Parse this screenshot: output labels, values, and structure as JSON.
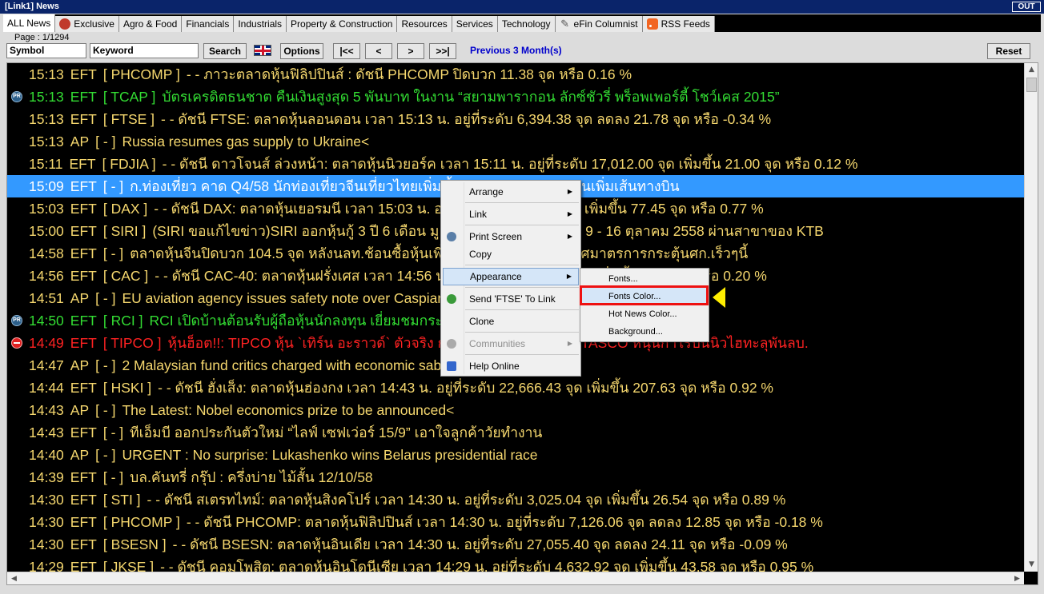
{
  "window": {
    "title": "[Link1] News",
    "out_label": "OUT"
  },
  "tabs": [
    {
      "label": "ALL News",
      "icon": ""
    },
    {
      "label": "Exclusive",
      "icon": "exclusive-icon"
    },
    {
      "label": "Agro & Food",
      "icon": ""
    },
    {
      "label": "Financials",
      "icon": ""
    },
    {
      "label": "Industrials",
      "icon": ""
    },
    {
      "label": "Property & Construction",
      "icon": ""
    },
    {
      "label": "Resources",
      "icon": ""
    },
    {
      "label": "Services",
      "icon": ""
    },
    {
      "label": "Technology",
      "icon": ""
    },
    {
      "label": "eFin Columnist",
      "icon": "pen-icon"
    },
    {
      "label": "RSS Feeds",
      "icon": "rss-icon"
    }
  ],
  "page_info": "Page : 1/1294",
  "controls": {
    "symbol_value": "Symbol",
    "keyword_value": "Keyword",
    "search_label": "Search",
    "options_label": "Options",
    "first_label": "|<<",
    "prev_label": "<",
    "next_label": ">",
    "last_label": ">>|",
    "previous_months_label": "Previous 3 Month(s)",
    "reset_label": "Reset"
  },
  "colors": {
    "normal": "#f5d76e",
    "pr": "#33dd33",
    "hot": "#ff2222",
    "selected_text": "#ffffff",
    "selected_bg": "#3399ff"
  },
  "news": [
    {
      "time": "15:13",
      "source": "EFT",
      "symbol": "[ PHCOMP ]",
      "text": "- - ภาวะตลาดหุ้นฟิลิปปินส์ :  ดัชนี PHCOMP  ปิดบวก   11.38 จุด หรือ 0.16 %",
      "type": "normal"
    },
    {
      "time": "15:13",
      "source": "EFT",
      "symbol": "[ TCAP ]",
      "text": "บัตรเครดิตธนชาต คืนเงินสูงสุด 5 พันบาท ในงาน “สยามพารากอน ลักซ์ชัวรี่ พร็อพเพอร์ตี้ โชว์เคส 2015”",
      "type": "pr"
    },
    {
      "time": "15:13",
      "source": "EFT",
      "symbol": "[ FTSE ]",
      "text": "- - ดัชนี FTSE: ตลาดหุ้นลอนดอน  เวลา 15:13 น.  อยู่ที่ระดับ 6,394.38 จุด ลดลง 21.78 จุด หรือ -0.34 %",
      "type": "normal"
    },
    {
      "time": "15:13",
      "source": "AP",
      "symbol": "[ - ]",
      "text": "Russia resumes gas supply to Ukraine<",
      "type": "normal"
    },
    {
      "time": "15:11",
      "source": "EFT",
      "symbol": "[ FDJIA ]",
      "text": "- - ดัชนี ดาวโจนส์ ล่วงหน้า: ตลาดหุ้นนิวยอร์ค  เวลา 15:11 น.  อยู่ที่ระดับ 17,012.00 จุด เพิ่มขึ้น 21.00 จุด หรือ 0.12 %",
      "type": "normal"
    },
    {
      "time": "15:09",
      "source": "EFT",
      "symbol": "[ - ]",
      "text": "ก.ท่องเที่ยว คาด Q4/58 นักท่องเที่ยวจีนเที่ยวไทยเพิ่มขึ้น หลังบริษัทสายการบินเพิ่มเส้นทางบิน",
      "type": "selected"
    },
    {
      "time": "15:03",
      "source": "EFT",
      "symbol": "[ DAX ]",
      "text": "- - ดัชนี DAX: ตลาดหุ้นเยอรมนี  เวลา 15:03 น.  อยู่ที่ระดับ 10,197.20 จุด เพิ่มขึ้น 77.45 จุด หรือ 0.77 %",
      "type": "normal"
    },
    {
      "time": "15:00",
      "source": "EFT",
      "symbol": "[ SIRI ]",
      "text": "(SIRI ขอแก้ไขข่าว)SIRI ออกหุ้นกู้ 3 ปี 6 เดือน มูลค่า 3,000 ลบ. เปิดขาย 9 - 16 ตุลาคม 2558 ผ่านสาขาของ KTB",
      "type": "normal"
    },
    {
      "time": "14:58",
      "source": "EFT",
      "symbol": "[ - ]",
      "text": "ตลาดหุ้นจีนปิดบวก 104.5 จุด หลังนลท.ช้อนซื้อหุ้นเพิ่ม คาดรัฐบาลจีนประกาศมาตรการกระตุ้นศก.เร็วๆนี้",
      "type": "normal"
    },
    {
      "time": "14:56",
      "source": "EFT",
      "symbol": "[ CAC ]",
      "text": "- - ดัชนี CAC-40: ตลาดหุ้นฝรั่งเศส  เวลา 14:56 น.  อยู่ที่ระดับ 4,657.17 จุด เพิ่มขึ้น 9.31 จุด หรือ 0.20 %",
      "type": "normal"
    },
    {
      "time": "14:51",
      "source": "AP",
      "symbol": "[ - ]",
      "text": "EU aviation agency issues safety note over Caspian Sea<",
      "type": "normal"
    },
    {
      "time": "14:50",
      "source": "EFT",
      "symbol": "[ RCI ]",
      "text": "RCI เปิดบ้านต้อนรับผู้ถือหุ้นนักลงทุน เยี่ยมชมกระบวนการผลิต",
      "type": "pr"
    },
    {
      "time": "14:49",
      "source": "EFT",
      "symbol": "[ TIPCO ]",
      "text": "หุ้นฮ็อต!!: TIPCO หุ้น `เทิร์น อะราวด์` ตัวจริง กำไรปีนี้พุ่ง พร้อมถือหุ้น TASCO หนุนกำไรปีนี้นิวไฮทะลุพันลบ.",
      "type": "hot"
    },
    {
      "time": "14:47",
      "source": "AP",
      "symbol": "[ - ]",
      "text": "2 Malaysian fund critics charged with economic sabotage<",
      "type": "normal"
    },
    {
      "time": "14:44",
      "source": "EFT",
      "symbol": "[ HSKI ]",
      "text": "- - ดัชนี ฮั่งเส็ง: ตลาดหุ้นฮ่องกง  เวลา 14:43 น.  อยู่ที่ระดับ 22,666.43 จุด เพิ่มขึ้น 207.63 จุด หรือ 0.92 %",
      "type": "normal"
    },
    {
      "time": "14:43",
      "source": "AP",
      "symbol": "[ - ]",
      "text": "The Latest: Nobel economics prize to be announced<",
      "type": "normal"
    },
    {
      "time": "14:43",
      "source": "EFT",
      "symbol": "[ - ]",
      "text": "ทีเอ็มบี ออกประกันตัวใหม่ “ไลฟ์ เซฟเว่อร์ 15/9” เอาใจลูกค้าวัยทำงาน",
      "type": "normal"
    },
    {
      "time": "14:40",
      "source": "AP",
      "symbol": "[ - ]",
      "text": "URGENT : No surprise: Lukashenko wins Belarus presidential race",
      "type": "normal"
    },
    {
      "time": "14:39",
      "source": "EFT",
      "symbol": "[ - ]",
      "text": "บล.คันทรี่ กรุ๊ป : ครึ่งบ่าย ไม้สั้น 12/10/58",
      "type": "normal"
    },
    {
      "time": "14:30",
      "source": "EFT",
      "symbol": "[ STI ]",
      "text": "- - ดัชนี สเตรทไทม์: ตลาดหุ้นสิงคโปร์  เวลา 14:30 น.  อยู่ที่ระดับ 3,025.04 จุด เพิ่มขึ้น 26.54 จุด หรือ 0.89 %",
      "type": "normal"
    },
    {
      "time": "14:30",
      "source": "EFT",
      "symbol": "[ PHCOMP ]",
      "text": "- - ดัชนี PHCOMP: ตลาดหุ้นฟิลิปปินส์  เวลา 14:30 น.  อยู่ที่ระดับ 7,126.06 จุด ลดลง 12.85 จุด หรือ -0.18 %",
      "type": "normal"
    },
    {
      "time": "14:30",
      "source": "EFT",
      "symbol": "[ BSESN ]",
      "text": "- - ดัชนี BSESN: ตลาดหุ้นอินเดีย  เวลา 14:30 น.  อยู่ที่ระดับ 27,055.40 จุด ลดลง 24.11 จุด หรือ -0.09 %",
      "type": "normal"
    },
    {
      "time": "14:29",
      "source": "EFT",
      "symbol": "[ JKSE ]",
      "text": "- - ดัชนี คอมโพสิต: ตลาดหุ้นอินโดนีเซีย  เวลา 14:29 น.  อยู่ที่ระดับ 4,632.92 จุด เพิ่มขึ้น 43.58 จุด หรือ 0.95 %",
      "type": "normal"
    }
  ],
  "context_menu": {
    "items": [
      {
        "label": "Arrange",
        "submenu": true,
        "disabled": false,
        "icon": ""
      },
      {
        "label": "Link",
        "submenu": true,
        "disabled": false,
        "icon": ""
      },
      {
        "label": "Print Screen",
        "submenu": true,
        "disabled": false,
        "icon": "printer-icon"
      },
      {
        "label": "Copy",
        "submenu": false,
        "disabled": false,
        "icon": ""
      },
      {
        "label": "Appearance",
        "submenu": true,
        "disabled": false,
        "icon": ""
      },
      {
        "label": "Send 'FTSE' To Link",
        "submenu": false,
        "disabled": false,
        "icon": "send-icon"
      },
      {
        "label": "Clone",
        "submenu": false,
        "disabled": false,
        "icon": ""
      },
      {
        "label": "Communities",
        "submenu": true,
        "disabled": true,
        "icon": "communities-icon"
      },
      {
        "label": "Help Online",
        "submenu": false,
        "disabled": false,
        "icon": "help-icon"
      }
    ],
    "highlighted": "Appearance"
  },
  "appearance_submenu": {
    "items": [
      "Fonts...",
      "Fonts Color...",
      "Hot News Color...",
      "Background..."
    ],
    "highlighted": "Fonts Color..."
  }
}
